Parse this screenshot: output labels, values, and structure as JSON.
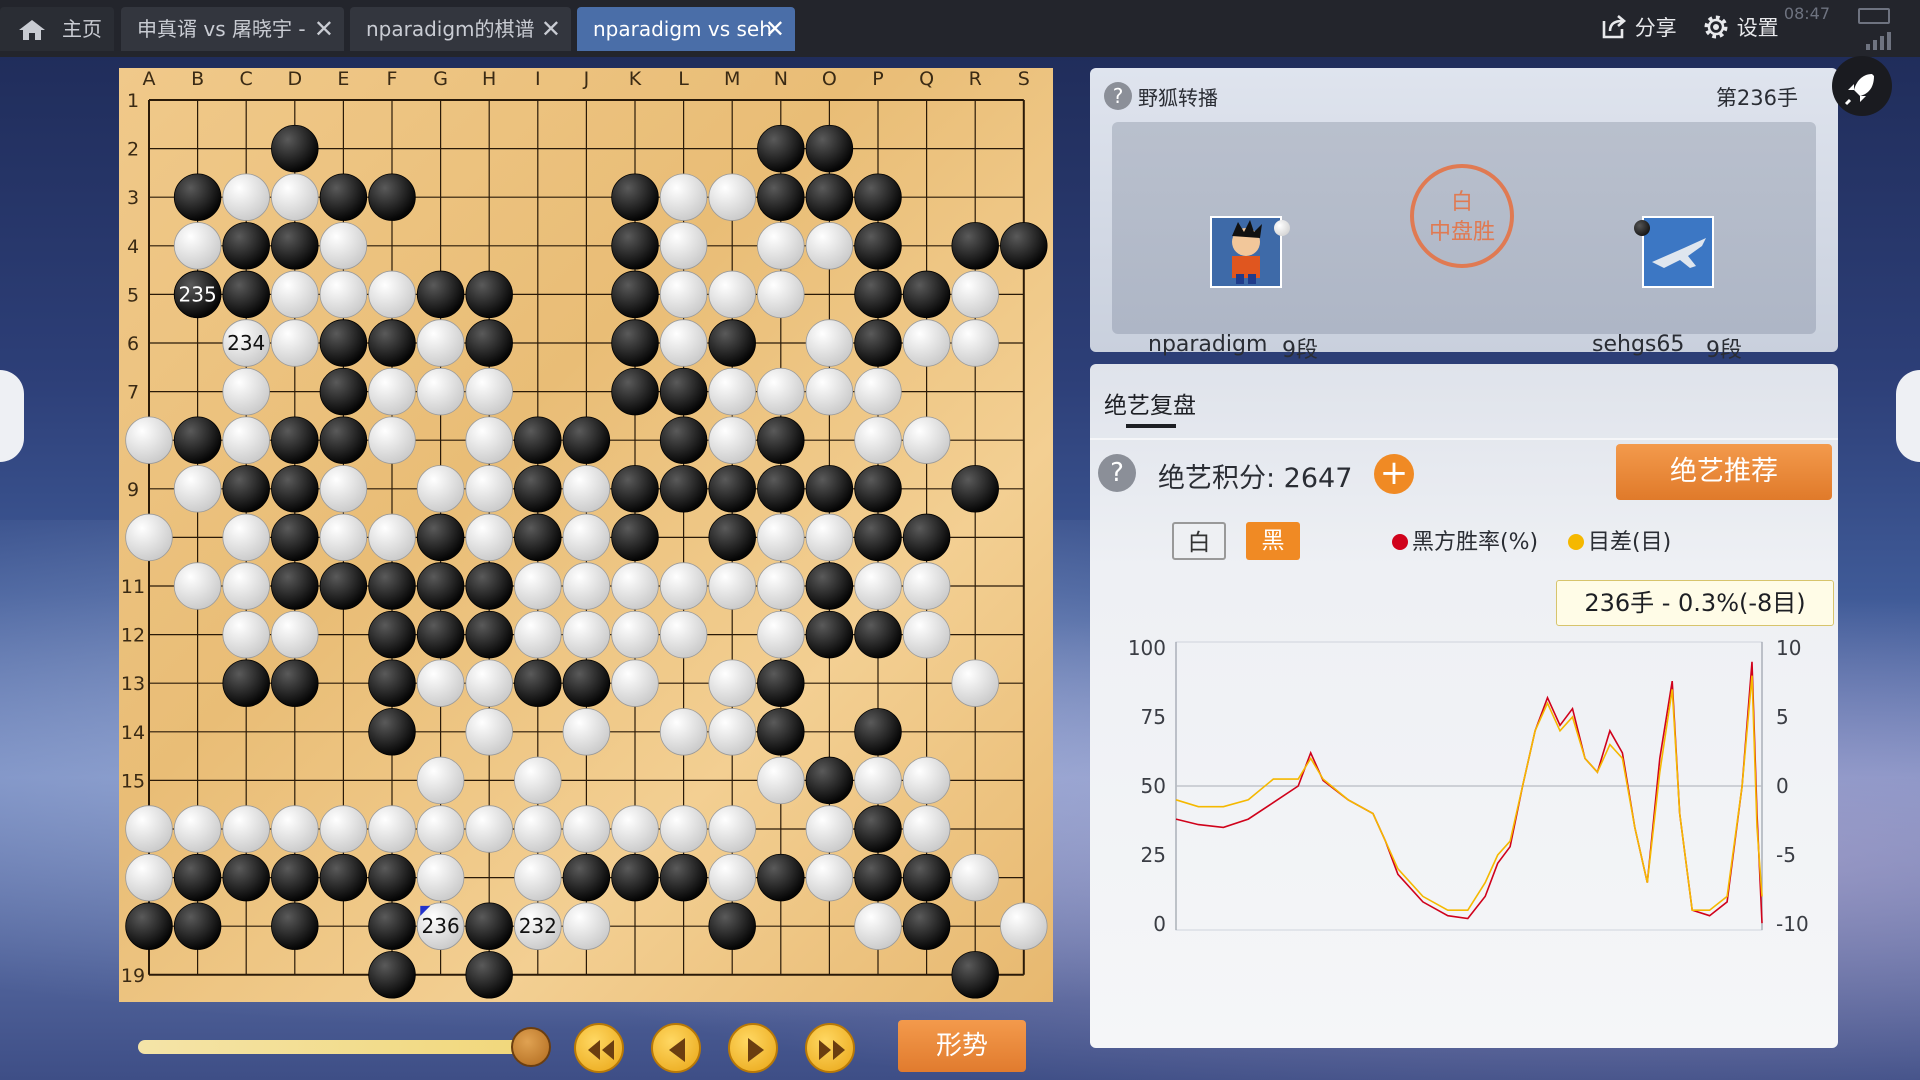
{
  "tabs": [
    {
      "label": "主页",
      "icon": "home-icon"
    },
    {
      "label": "申真谞 vs 屠晓宇 -",
      "closable": true
    },
    {
      "label": "nparadigm的棋谱",
      "closable": true
    },
    {
      "label": "nparadigm vs seh",
      "closable": true,
      "active": true
    }
  ],
  "toolbar": {
    "share_label": "分享",
    "settings_label": "设置",
    "clock": "08:47"
  },
  "board": {
    "size": 19,
    "columns": [
      "A",
      "B",
      "C",
      "D",
      "E",
      "F",
      "G",
      "H",
      "I",
      "J",
      "K",
      "L",
      "M",
      "N",
      "O",
      "P",
      "Q",
      "R",
      "S"
    ],
    "rows": [
      "1",
      "2",
      "3",
      "4",
      "5",
      "6",
      "7",
      "8",
      "9",
      "10",
      "11",
      "12",
      "13",
      "14",
      "15",
      "16",
      "17",
      "18",
      "19"
    ],
    "row_labels_drawn": [
      "1",
      "2",
      "3",
      "4",
      "5",
      "6",
      "7",
      "",
      "9",
      "",
      "11",
      "12",
      "13",
      "14",
      "15",
      "",
      "",
      "",
      "19"
    ],
    "lines": [
      ".................."
    ],
    "stones": [
      "...................",
      "...B.........BB....",
      ".BWWBB....BWWBBB...",
      ".WBBW.....BW.WWB.BB",
      ".BBWWWBB..BWWW.BBW.",
      "..WWBBWB..BWB.WBWW.",
      "..W.BWWW..BBWWWW...",
      "WBWBBW.WBB.BWB.WW..",
      ".WBBW.WWBWBBBBBB.B.",
      "W.WBWWBWBWB.BWWBB..",
      ".WWBBBBBWWWWWWBWW..",
      "..WW.BBBWWWW.WBBW..",
      "..BB.BWWBBW.WB...W.",
      ".....B.W.W.WWB.B...",
      "......W.W....WBWW..",
      "WWWWWWWWWWWWW.WBW..",
      "WBBBBBW.WBBBWBWBBW.",
      "BB.B.BWBWW..B..WB.W",
      ".....B.B.........B."
    ],
    "labeled_stones": [
      {
        "label": "235",
        "col": "B",
        "row": "5",
        "color": "black"
      },
      {
        "label": "234",
        "col": "C",
        "row": "6",
        "color": "white"
      },
      {
        "label": "236",
        "col": "G",
        "row": "18",
        "color": "white"
      },
      {
        "label": "232",
        "col": "I",
        "row": "18",
        "color": "white"
      }
    ],
    "star_point": {
      "col": "P",
      "row": "4"
    },
    "last_move": {
      "col": "G",
      "row": "18"
    }
  },
  "controls": {
    "progress": 0.82,
    "shape_label": "形势"
  },
  "game_info": {
    "source": "野狐转播",
    "move_number": "第236手",
    "player_white": {
      "name": "nparadigm",
      "rank": "9段"
    },
    "player_black": {
      "name": "sehgs65",
      "rank": "9段"
    },
    "result_line1": "白",
    "result_line2": "中盘胜"
  },
  "review": {
    "tab_label": "绝艺复盘",
    "score_label": "绝艺积分: 2647",
    "recommend_label": "绝艺推荐",
    "side_white": "白",
    "side_black": "黑",
    "legend_winrate": "黑方胜率(%)",
    "legend_diff": "目差(目)",
    "tooltip": "236手 - 0.3%(-8目)"
  },
  "colors": {
    "winrate": "#d0021b",
    "diff": "#f5b800",
    "accent": "#e07a2a",
    "tab_active": "#4a6ea8"
  },
  "chart_data": {
    "type": "line",
    "x_label": "",
    "y_left": {
      "ticks": [
        "100",
        "75",
        "50",
        "25",
        "0"
      ],
      "range": [
        0,
        100
      ]
    },
    "y_right": {
      "ticks": [
        "10",
        "5",
        "0",
        "-5",
        "-10"
      ],
      "range": [
        -10,
        10
      ]
    },
    "x_range": [
      1,
      236
    ],
    "series": [
      {
        "name": "黑方胜率(%)",
        "axis": "left",
        "color": "#d0021b",
        "points": [
          [
            1,
            38
          ],
          [
            10,
            36
          ],
          [
            20,
            35
          ],
          [
            30,
            38
          ],
          [
            40,
            44
          ],
          [
            50,
            50
          ],
          [
            55,
            62
          ],
          [
            60,
            52
          ],
          [
            70,
            45
          ],
          [
            80,
            40
          ],
          [
            85,
            30
          ],
          [
            90,
            18
          ],
          [
            100,
            8
          ],
          [
            110,
            3
          ],
          [
            118,
            2
          ],
          [
            125,
            10
          ],
          [
            130,
            22
          ],
          [
            135,
            28
          ],
          [
            140,
            50
          ],
          [
            145,
            70
          ],
          [
            150,
            82
          ],
          [
            155,
            72
          ],
          [
            160,
            78
          ],
          [
            165,
            60
          ],
          [
            170,
            55
          ],
          [
            175,
            70
          ],
          [
            180,
            62
          ],
          [
            185,
            35
          ],
          [
            190,
            15
          ],
          [
            195,
            60
          ],
          [
            200,
            88
          ],
          [
            203,
            40
          ],
          [
            208,
            5
          ],
          [
            215,
            3
          ],
          [
            222,
            8
          ],
          [
            228,
            50
          ],
          [
            232,
            95
          ],
          [
            234,
            40
          ],
          [
            236,
            0.3
          ]
        ]
      },
      {
        "name": "目差(目)",
        "axis": "right",
        "color": "#f5b800",
        "points": [
          [
            1,
            -1
          ],
          [
            10,
            -1.5
          ],
          [
            20,
            -1.5
          ],
          [
            30,
            -1
          ],
          [
            40,
            0.5
          ],
          [
            50,
            0.5
          ],
          [
            55,
            2
          ],
          [
            60,
            0.5
          ],
          [
            70,
            -1
          ],
          [
            80,
            -2
          ],
          [
            85,
            -4
          ],
          [
            90,
            -6
          ],
          [
            100,
            -8
          ],
          [
            110,
            -9
          ],
          [
            118,
            -9
          ],
          [
            125,
            -7
          ],
          [
            130,
            -5
          ],
          [
            135,
            -4
          ],
          [
            140,
            0
          ],
          [
            145,
            4
          ],
          [
            150,
            6
          ],
          [
            155,
            4
          ],
          [
            160,
            5
          ],
          [
            165,
            2
          ],
          [
            170,
            1
          ],
          [
            175,
            3
          ],
          [
            180,
            2
          ],
          [
            185,
            -3
          ],
          [
            190,
            -7
          ],
          [
            195,
            1
          ],
          [
            200,
            7
          ],
          [
            203,
            -2
          ],
          [
            208,
            -9
          ],
          [
            215,
            -9
          ],
          [
            222,
            -8
          ],
          [
            228,
            0
          ],
          [
            232,
            8
          ],
          [
            234,
            -3
          ],
          [
            236,
            -8
          ]
        ]
      }
    ]
  }
}
